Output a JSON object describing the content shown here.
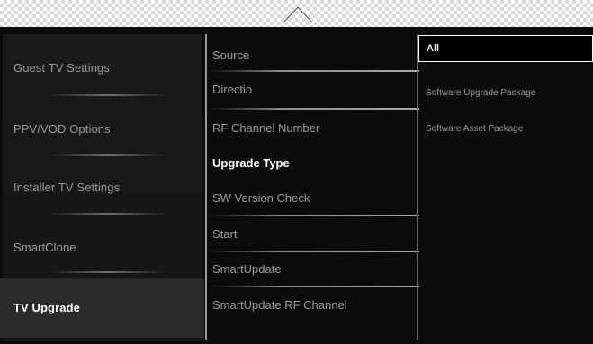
{
  "menu": {
    "categories": [
      {
        "label": "Guest TV Settings",
        "active": false
      },
      {
        "label": "PPV/VOD Options",
        "active": false
      },
      {
        "label": "Installer TV Settings",
        "active": false
      },
      {
        "label": "SmartClone",
        "active": false
      },
      {
        "label": "TV Upgrade",
        "active": true
      }
    ],
    "settings": [
      {
        "label": "Source",
        "emphasized": false
      },
      {
        "label": "Directio",
        "emphasized": false
      },
      {
        "label": "RF Channel Number",
        "emphasized": false
      },
      {
        "label": "Upgrade Type",
        "emphasized": true
      },
      {
        "label": "SW Version Check",
        "emphasized": false
      },
      {
        "label": "Start",
        "emphasized": false
      },
      {
        "label": "SmartUpdate",
        "emphasized": false
      },
      {
        "label": "SmartUpdate RF Channel",
        "emphasized": false
      }
    ],
    "options": {
      "selected": "All",
      "items": [
        "Software Upgrade Package",
        "Software Asset Package"
      ]
    }
  },
  "icons": {
    "scroll_up": "chevron-up-icon"
  },
  "colors": {
    "background": "#0b0b0b",
    "active_category": "#2a2a2a",
    "text_dim": "#9a9a9a",
    "text_bright": "#ffffff"
  }
}
